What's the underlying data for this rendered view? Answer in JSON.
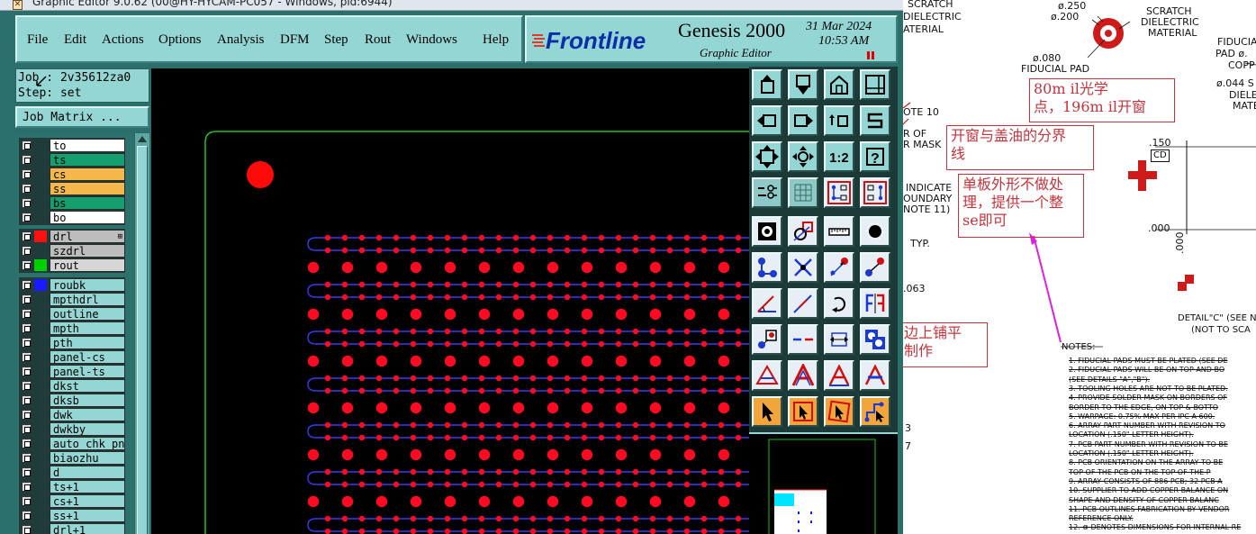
{
  "window": {
    "title": "Graphic Editor 9.0.62 (00@HY-HYCAM-PC057 - Windows, pid:6944)"
  },
  "menu": {
    "items": [
      "File",
      "Edit",
      "Actions",
      "Options",
      "Analysis",
      "DFM",
      "Step",
      "Rout",
      "Windows"
    ],
    "help": "Help"
  },
  "brand": {
    "logo": "Frontline",
    "product": "Genesis 2000",
    "subtitle": "Graphic Editor",
    "date": "31 Mar 2024",
    "time": "10:53 AM"
  },
  "job": {
    "job_line": "Job : 2v35612za0",
    "step_line": "Step: set",
    "matrix_button": "Job Matrix ..."
  },
  "layers": {
    "board": [
      {
        "name": "to",
        "color": "#ffffff"
      },
      {
        "name": "ts",
        "color": "#159e6e"
      },
      {
        "name": "cs",
        "color": "#f4b84a"
      },
      {
        "name": "ss",
        "color": "#f4b84a"
      },
      {
        "name": "bs",
        "color": "#159e6e"
      },
      {
        "name": "bo",
        "color": "#ffffff"
      }
    ],
    "drill": [
      {
        "name": "drl",
        "color": "#bdbdbd",
        "swatch": "#ff1010",
        "active": true
      },
      {
        "name": "szdrl",
        "color": "#bdbdbd",
        "swatch": "#1f3c3b"
      },
      {
        "name": "rout",
        "color": "#d6d6d6",
        "swatch": "#00d000"
      }
    ],
    "misc": [
      {
        "name": "roubk",
        "color": "#93d6d4",
        "swatch": "#1a1aff"
      },
      {
        "name": "mpthdrl",
        "color": "#93d6d4"
      },
      {
        "name": "outline",
        "color": "#93d6d4"
      },
      {
        "name": "mpth",
        "color": "#93d6d4"
      },
      {
        "name": "pth",
        "color": "#93d6d4"
      },
      {
        "name": "panel-cs",
        "color": "#93d6d4"
      },
      {
        "name": "panel-ts",
        "color": "#93d6d4"
      },
      {
        "name": "dkst",
        "color": "#93d6d4"
      },
      {
        "name": "dksb",
        "color": "#93d6d4"
      },
      {
        "name": "dwk",
        "color": "#93d6d4"
      },
      {
        "name": "dwkby",
        "color": "#93d6d4"
      },
      {
        "name": "auto_chk_pn",
        "color": "#93d6d4"
      },
      {
        "name": "biaozhu",
        "color": "#93d6d4"
      },
      {
        "name": "d",
        "color": "#93d6d4"
      },
      {
        "name": "ts+1",
        "color": "#93d6d4"
      },
      {
        "name": "cs+1",
        "color": "#93d6d4"
      },
      {
        "name": "ss+1",
        "color": "#93d6d4"
      },
      {
        "name": "drl+1",
        "color": "#93d6d4"
      }
    ]
  },
  "tools": [
    "layer-up-icon",
    "layer-down-icon",
    "home-view-icon",
    "window-frame-icon",
    "pan-left-icon",
    "pan-right-icon",
    "redraw-icon",
    "snap-s-icon",
    "fit-vertical-icon",
    "fit-screen-icon",
    "zoom-1-2-icon",
    "help-query-icon",
    "measure-tool-icon",
    "grid-icon",
    "net-connect-icon",
    "net-compare-icon",
    "pad-select-icon",
    "shape-edit-icon",
    "ruler-icon",
    "dot-feature-icon",
    "connect-nodes-icon",
    "cross-x-icon",
    "move-point-icon",
    "move-pad-icon",
    "angle-line-icon",
    "line-pen-icon",
    "rotate-icon",
    "mirror-f-icon",
    "snap-pad-icon",
    "break-line-icon",
    "resize-frame-icon",
    "copy-circles-icon",
    "poly-a-icon",
    "poly-a-red-icon",
    "arc-a-icon",
    "arc-a-fill-icon",
    "select-arrow-icon",
    "select-box-icon",
    "select-pick-icon",
    "route-select-icon"
  ],
  "canvas_colors": {
    "background": "#000000",
    "outline": "#22c322",
    "drill": "#ff0a22",
    "route": "#3a3af0",
    "fiducial": "#ff0a0a"
  },
  "doc": {
    "scratch1": "SCRATCH",
    "dielectric1": "DIELECTRIC",
    "material1": "ATERIAL",
    "d250": "ø.250",
    "d200": "ø.200",
    "scratch2": "SCRATCH",
    "dielectric2": "DIELECTRIC",
    "material2": "MATERIAL",
    "d080": "ø.080",
    "fiducial_pad": "FIDUCIAL PAD",
    "fiducial": "FIDUCIAL",
    "pad_line": "PAD  ø.",
    "copp": "COPP",
    "d044": "ø.044 S",
    "diele": "DIELEC",
    "mate": "MATE",
    "note10": "OTE 10",
    "or": "R OF",
    "rmask": "R MASK",
    "indicate": "INDICATE",
    "oundary": "OUNDARY",
    "note11": "NOTE 11)",
    "typ": "TYP.",
    "v063": ".063",
    "v150": ".150",
    "cd": "CD",
    "v000a": ".000",
    "v000b": ".000",
    "detail": "DETAIL\"C\" (SEE N",
    "notscale": "(NOT TO SCA",
    "n3": "3",
    "n7": "7",
    "notes_head": "NOTES:",
    "notes": [
      "1. FIDUCIAL PADS MUST BE PLATED (SEE DE",
      "2. FIDUCIAL PADS WILL BE ON TOP AND BO",
      "   (SEE DETAILS \"A\",\"B\").",
      "3. TOOLING HOLES ARE NOT TO BE PLATED.",
      "4. PROVIDE SOLDER MASK ON BORDERS OF",
      "   BORDER TO THE EDGE, ON TOP & BOTTO",
      "5. WARPAGE: 0.75% MAX PER IPC A 600.",
      "6. ARRAY PART NUMBER WITH REVISION TO",
      "   LOCATION (.150\" LETTER HEIGHT).",
      "7. PCB PART NUMBER WITH REVISION TO BE",
      "   LOCATION (.150\" LETTER HEIGHT).",
      "8. PCB ORIENTATION ON THE ARRAY TO BE",
      "   TOP OF THE PCB ON THE TOP OF THE P",
      "9. ARRAY CONSISTS OF 886 PCB; 32 PCB A",
      "10. SUPPLIER TO ADD COPPER BALANCE ON",
      "    SHAPE AND DENSITY OF COPPER BALANC",
      "11. PCB OUTLINES FABRICATION BY VENDOR",
      "    REFERENCE ONLY.",
      "12. ⊗ DENOTES DIMENSIONS FOR INTERNAL RE"
    ]
  },
  "annotations": {
    "a1_line1": "80m il光学",
    "a1_line2": "点，196m il开窗",
    "a2_line1": "开窗与盖油的分界",
    "a2_line2": "线",
    "a3_line1": "单板外形不做处",
    "a3_line2": "理，提供一个整",
    "a3_line3": "se即可",
    "a4_line1": "边上铺平",
    "a4_line2": "制作"
  }
}
